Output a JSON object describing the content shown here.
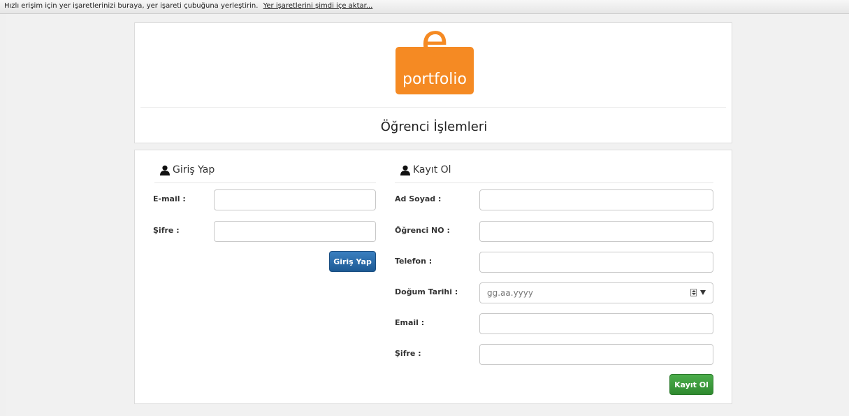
{
  "bookmarks_bar": {
    "message": "Hızlı erişim için yer işaretlerinizi buraya, yer işareti çubuğuna yerleştirin.",
    "import_link": "Yer işaretlerini şimdi içe aktar..."
  },
  "logo": {
    "letter": "e",
    "word": "portfolio",
    "color": "#f58a23"
  },
  "header": {
    "title": "Öğrenci İşlemleri"
  },
  "login": {
    "heading": "Giriş Yap",
    "email_label": "E-mail :",
    "password_label": "Şifre :",
    "submit_label": "Giriş Yap"
  },
  "register": {
    "heading": "Kayıt Ol",
    "name_label": "Ad Soyad :",
    "student_no_label": "Öğrenci NO :",
    "phone_label": "Telefon :",
    "birthdate_label": "Doğum Tarihi :",
    "birthdate_placeholder": "gg.aa.yyyy",
    "email_label": "Email :",
    "password_label": "Şifre :",
    "submit_label": "Kayıt Ol"
  },
  "colors": {
    "primary_button": "#1d5a94",
    "success_button": "#2f8a2f"
  }
}
